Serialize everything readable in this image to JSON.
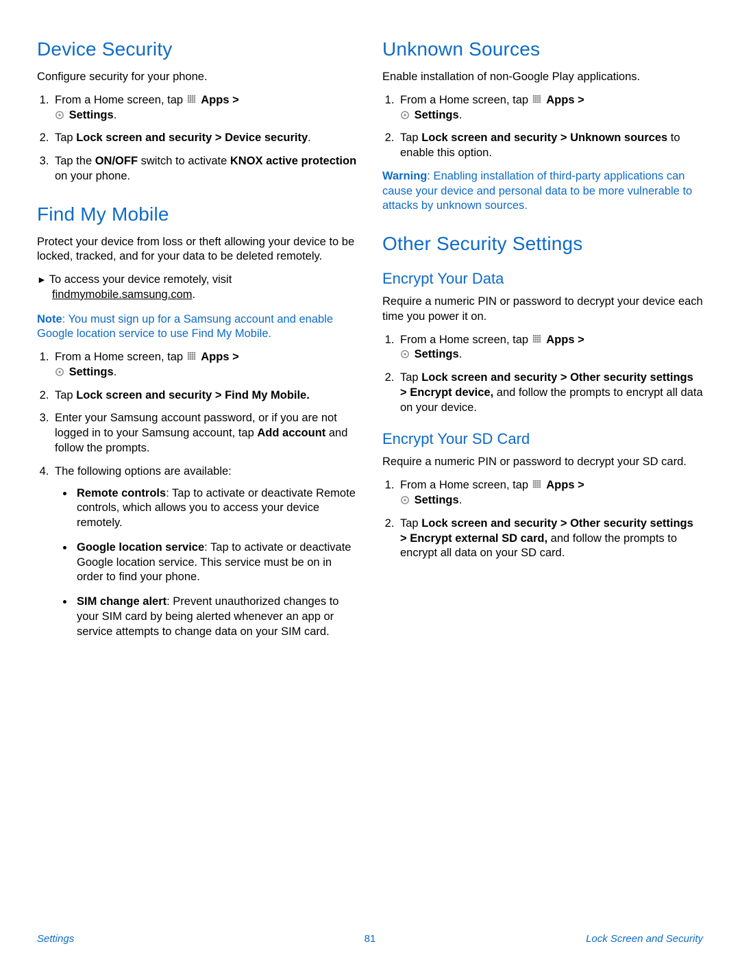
{
  "left": {
    "h_device_security": "Device Security",
    "ds_intro": "Configure security for your phone.",
    "ds_step1_a": "From a Home screen, tap ",
    "apps": "Apps",
    "gt": " > ",
    "settings": "Settings",
    "period": ".",
    "ds_step2_a": "Tap ",
    "ds_step2_b": "Lock screen and security > Device security",
    "ds_step3_a": "Tap the ",
    "ds_step3_b": "ON/OFF",
    "ds_step3_c": " switch to activate ",
    "ds_step3_d": "KNOX active protection",
    "ds_step3_e": " on your phone.",
    "h_find_my_mobile": "Find My Mobile",
    "fmm_intro": "Protect your device from loss or theft allowing your device to be locked, tracked, and for your data to be deleted remotely.",
    "fmm_access_a": "To access your device remotely, visit ",
    "fmm_link": "findmymobile.samsung.com",
    "fmm_note_b": "Note",
    "fmm_note_rest": ": You must sign up for a Samsung account and enable Google location service to use Find My Mobile.",
    "fmm_step2_b": "Lock screen and security > Find My Mobile.",
    "fmm_step3_a": "Enter your Samsung account password, or if you are not logged in to your Samsung account, tap ",
    "fmm_step3_b": "Add account",
    "fmm_step3_c": " and follow the prompts.",
    "fmm_step4": "The following options are available:",
    "fmm_opt1_b": "Remote controls",
    "fmm_opt1_r": ": Tap to activate or deactivate Remote controls, which allows you to access your device remotely.",
    "fmm_opt2_b": "Google location service",
    "fmm_opt2_r": ": Tap to activate or deactivate Google location service. This service must be on in order to find your phone.",
    "fmm_opt3_b": "SIM change alert",
    "fmm_opt3_r": ": Prevent unauthorized changes to your SIM card by being alerted whenever an app or service attempts to change data on your SIM card."
  },
  "right": {
    "h_unknown_sources": "Unknown Sources",
    "us_intro": "Enable installation of non-Google Play applications.",
    "us_step2_a": "Tap ",
    "us_step2_b": "Lock screen and security > Unknown sources",
    "us_step2_c": " to enable this option.",
    "us_warn_b": "Warning",
    "us_warn_r": ": Enabling installation of third-party applications can cause your device and personal data to be more vulnerable to attacks by unknown sources.",
    "h_other_security": "Other Security Settings",
    "h_encrypt_data": "Encrypt Your Data",
    "ed_intro": "Require a numeric PIN or password to decrypt your device each time you power it on.",
    "ed_step2_a": "Tap ",
    "ed_step2_b": "Lock screen and security > Other security settings > Encrypt device,",
    "ed_step2_c": " and follow the prompts to encrypt all data on your device.",
    "h_encrypt_sd": "Encrypt Your SD Card",
    "sd_intro": "Require a numeric PIN or password to decrypt your SD card.",
    "sd_step2_a": "Tap ",
    "sd_step2_b": "Lock screen and security > Other security settings > Encrypt external SD card,",
    "sd_step2_c": " and follow the prompts to encrypt all data on your SD card."
  },
  "footer": {
    "left": "Settings",
    "center": "81",
    "right": "Lock Screen and Security"
  }
}
